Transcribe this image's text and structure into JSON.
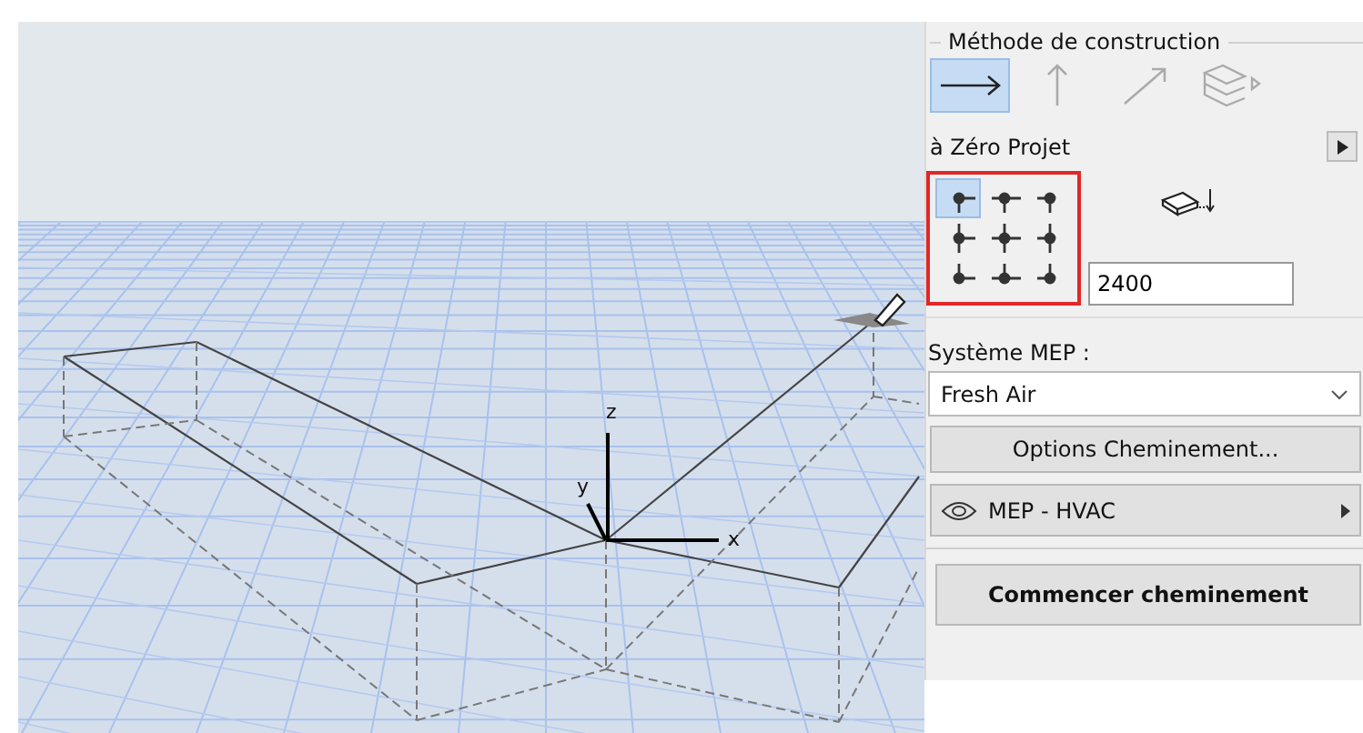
{
  "viewport": {
    "axis_labels": [
      {
        "kind": "z",
        "text": "z"
      },
      {
        "kind": "y",
        "text": "y"
      },
      {
        "kind": "x",
        "text": "x"
      }
    ]
  },
  "panel": {
    "method_title": "Méthode de construction",
    "methods": [
      {
        "kind": "horizontal",
        "selected": true
      },
      {
        "kind": "vertical",
        "selected": false
      },
      {
        "kind": "inclined",
        "selected": false
      },
      {
        "kind": "plane",
        "selected": false
      }
    ],
    "reference": "à Zéro Projet",
    "anchors": [
      {
        "selected": true
      },
      {
        "selected": false
      },
      {
        "selected": false
      },
      {
        "selected": false
      },
      {
        "selected": false
      },
      {
        "selected": false
      },
      {
        "selected": false
      },
      {
        "selected": false
      },
      {
        "selected": false
      }
    ],
    "elevation": "2400",
    "mep_label": "Système MEP :",
    "mep_system": "Fresh Air",
    "routing_options": "Options Cheminement...",
    "layer": "MEP - HVAC",
    "start": "Commencer cheminement"
  }
}
